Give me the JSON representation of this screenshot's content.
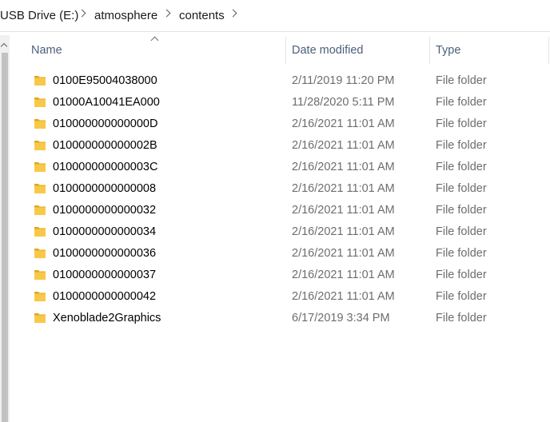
{
  "breadcrumb": {
    "items": [
      "USB Drive (E:)",
      "atmosphere",
      "contents"
    ]
  },
  "columns": {
    "name": "Name",
    "date": "Date modified",
    "type": "Type"
  },
  "files": [
    {
      "name": "0100E95004038000",
      "date": "2/11/2019 11:20 PM",
      "type": "File folder"
    },
    {
      "name": "01000A10041EA000",
      "date": "11/28/2020 5:11 PM",
      "type": "File folder"
    },
    {
      "name": "010000000000000D",
      "date": "2/16/2021 11:01 AM",
      "type": "File folder"
    },
    {
      "name": "010000000000002B",
      "date": "2/16/2021 11:01 AM",
      "type": "File folder"
    },
    {
      "name": "010000000000003C",
      "date": "2/16/2021 11:01 AM",
      "type": "File folder"
    },
    {
      "name": "0100000000000008",
      "date": "2/16/2021 11:01 AM",
      "type": "File folder"
    },
    {
      "name": "0100000000000032",
      "date": "2/16/2021 11:01 AM",
      "type": "File folder"
    },
    {
      "name": "0100000000000034",
      "date": "2/16/2021 11:01 AM",
      "type": "File folder"
    },
    {
      "name": "0100000000000036",
      "date": "2/16/2021 11:01 AM",
      "type": "File folder"
    },
    {
      "name": "0100000000000037",
      "date": "2/16/2021 11:01 AM",
      "type": "File folder"
    },
    {
      "name": "0100000000000042",
      "date": "2/16/2021 11:01 AM",
      "type": "File folder"
    },
    {
      "name": "Xenoblade2Graphics",
      "date": "6/17/2019 3:34 PM",
      "type": "File folder"
    }
  ],
  "icons": {
    "folder": "folder-icon",
    "breadcrumb_separator": "chevron-right-icon",
    "sort": "sort-ascending-icon",
    "scroll_up": "chevron-up-icon"
  },
  "colors": {
    "header_text": "#4c607a",
    "secondary_text": "#6d6d6d",
    "folder_yellow": "#f8c948",
    "folder_dark": "#e0a81e"
  }
}
